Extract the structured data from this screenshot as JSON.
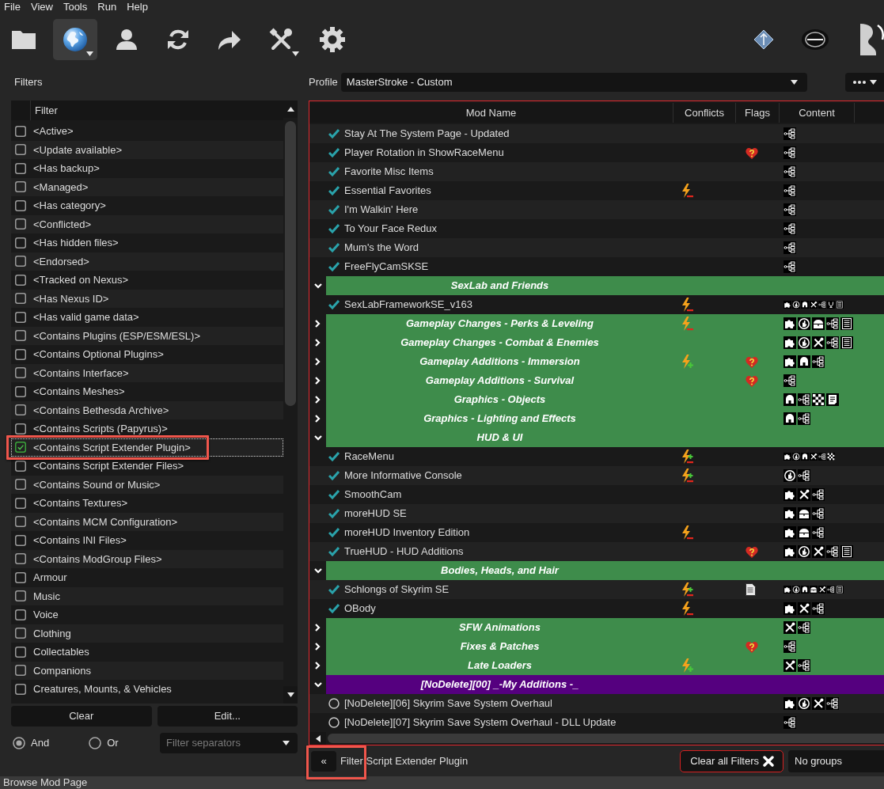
{
  "menu": [
    "File",
    "View",
    "Tools",
    "Run",
    "Help"
  ],
  "toolbar": {
    "buttons": [
      {
        "kind": "folder",
        "selected": false,
        "dropdown": false
      },
      {
        "kind": "globe",
        "selected": true,
        "dropdown": true
      },
      {
        "kind": "person",
        "selected": false,
        "dropdown": false
      },
      {
        "kind": "refresh",
        "selected": false,
        "dropdown": false
      },
      {
        "kind": "redo",
        "selected": false,
        "dropdown": false
      },
      {
        "kind": "tools",
        "selected": false,
        "dropdown": true
      },
      {
        "kind": "gear",
        "selected": false,
        "dropdown": false
      }
    ],
    "launchers": [
      {
        "kind": "diamond"
      },
      {
        "kind": "oval"
      },
      {
        "kind": "partial"
      }
    ]
  },
  "filters": {
    "title": "Filters",
    "column_header": "Filter",
    "items": [
      {
        "label": "<Active>",
        "checked": false,
        "selected": false,
        "highlighted": false
      },
      {
        "label": "<Update available>",
        "checked": false,
        "selected": false,
        "highlighted": false
      },
      {
        "label": "<Has backup>",
        "checked": false,
        "selected": false,
        "highlighted": false
      },
      {
        "label": "<Managed>",
        "checked": false,
        "selected": false,
        "highlighted": false
      },
      {
        "label": "<Has category>",
        "checked": false,
        "selected": false,
        "highlighted": false
      },
      {
        "label": "<Conflicted>",
        "checked": false,
        "selected": false,
        "highlighted": false
      },
      {
        "label": "<Has hidden files>",
        "checked": false,
        "selected": false,
        "highlighted": false
      },
      {
        "label": "<Endorsed>",
        "checked": false,
        "selected": false,
        "highlighted": false
      },
      {
        "label": "<Tracked on Nexus>",
        "checked": false,
        "selected": false,
        "highlighted": false
      },
      {
        "label": "<Has Nexus ID>",
        "checked": false,
        "selected": false,
        "highlighted": false
      },
      {
        "label": "<Has valid game data>",
        "checked": false,
        "selected": false,
        "highlighted": false
      },
      {
        "label": "<Contains Plugins (ESP/ESM/ESL)>",
        "checked": false,
        "selected": false,
        "highlighted": false
      },
      {
        "label": "<Contains Optional Plugins>",
        "checked": false,
        "selected": false,
        "highlighted": false
      },
      {
        "label": "<Contains Interface>",
        "checked": false,
        "selected": false,
        "highlighted": false
      },
      {
        "label": "<Contains Meshes>",
        "checked": false,
        "selected": false,
        "highlighted": false
      },
      {
        "label": "<Contains Bethesda Archive>",
        "checked": false,
        "selected": false,
        "highlighted": false
      },
      {
        "label": "<Contains Scripts (Papyrus)>",
        "checked": false,
        "selected": false,
        "highlighted": false
      },
      {
        "label": "<Contains Script Extender Plugin>",
        "checked": true,
        "selected": true,
        "highlighted": true
      },
      {
        "label": "<Contains Script Extender Files>",
        "checked": false,
        "selected": false,
        "highlighted": false
      },
      {
        "label": "<Contains Sound or Music>",
        "checked": false,
        "selected": false,
        "highlighted": false
      },
      {
        "label": "<Contains Textures>",
        "checked": false,
        "selected": false,
        "highlighted": false
      },
      {
        "label": "<Contains MCM Configuration>",
        "checked": false,
        "selected": false,
        "highlighted": false
      },
      {
        "label": "<Contains INI Files>",
        "checked": false,
        "selected": false,
        "highlighted": false
      },
      {
        "label": "<Contains ModGroup Files>",
        "checked": false,
        "selected": false,
        "highlighted": false
      },
      {
        "label": "Armour",
        "checked": false,
        "selected": false,
        "highlighted": false
      },
      {
        "label": "Music",
        "checked": false,
        "selected": false,
        "highlighted": false
      },
      {
        "label": "Voice",
        "checked": false,
        "selected": false,
        "highlighted": false
      },
      {
        "label": "Clothing",
        "checked": false,
        "selected": false,
        "highlighted": false
      },
      {
        "label": "Collectables",
        "checked": false,
        "selected": false,
        "highlighted": false
      },
      {
        "label": "Companions",
        "checked": false,
        "selected": false,
        "highlighted": false
      },
      {
        "label": "Creatures, Mounts, & Vehicles",
        "checked": false,
        "selected": false,
        "highlighted": false
      }
    ],
    "buttons": [
      "Clear",
      "Edit..."
    ],
    "modes": [
      {
        "label": "And",
        "selected": true
      },
      {
        "label": "Or",
        "selected": false
      }
    ],
    "separator_filter": {
      "placeholder": "Filter separators"
    }
  },
  "profile": {
    "label": "Profile",
    "value": "MasterStroke - Custom"
  },
  "mod_list": {
    "filter_active": true,
    "columns": [
      "Mod Name",
      "Conflicts",
      "Flags",
      "Content"
    ],
    "rows": [
      {
        "kind": "mod",
        "name": "Stay At The System Page - Updated",
        "active": true,
        "content": [
          {
            "kind": "scripts"
          }
        ]
      },
      {
        "kind": "mod",
        "name": "Player Rotation in ShowRaceMenu",
        "active": true,
        "flag": {
          "kind": "endorse"
        },
        "content": [
          {
            "kind": "scripts"
          }
        ]
      },
      {
        "kind": "mod",
        "name": "Favorite Misc Items",
        "active": true,
        "content": [
          {
            "kind": "scripts"
          }
        ]
      },
      {
        "kind": "mod",
        "name": "Essential Favorites",
        "active": true,
        "conflict": {
          "kind": "loses"
        },
        "content": [
          {
            "kind": "scripts"
          }
        ]
      },
      {
        "kind": "mod",
        "name": "I'm Walkin' Here",
        "active": true,
        "content": [
          {
            "kind": "scripts"
          }
        ]
      },
      {
        "kind": "mod",
        "name": "To Your Face Redux",
        "active": true,
        "content": [
          {
            "kind": "scripts"
          }
        ]
      },
      {
        "kind": "mod",
        "name": "Mum's the Word",
        "active": true,
        "content": [
          {
            "kind": "scripts"
          }
        ]
      },
      {
        "kind": "mod",
        "name": "FreeFlyCamSKSE",
        "active": true,
        "content": [
          {
            "kind": "scripts"
          }
        ]
      },
      {
        "kind": "separator",
        "name": "SexLab and Friends",
        "expanded": true,
        "color": "#3e8c4b"
      },
      {
        "kind": "mod",
        "name": "SexLabFrameworkSE_v163",
        "active": true,
        "conflict": {
          "kind": "loses"
        },
        "content": [
          {
            "kind": "plugins"
          },
          {
            "kind": "interface"
          },
          {
            "kind": "meshes"
          },
          {
            "kind": "skse"
          },
          {
            "kind": "scripts"
          },
          {
            "kind": "sound"
          },
          {
            "kind": "mcm"
          }
        ]
      },
      {
        "kind": "separator",
        "name": "Gameplay Changes - Perks & Leveling",
        "expanded": false,
        "color": "#3e8c4b",
        "conflict": {
          "kind": "loses"
        },
        "content": [
          {
            "kind": "plugins"
          },
          {
            "kind": "interface"
          },
          {
            "kind": "bsa"
          },
          {
            "kind": "scripts"
          },
          {
            "kind": "mcm"
          }
        ]
      },
      {
        "kind": "separator",
        "name": "Gameplay Changes - Combat & Enemies",
        "expanded": false,
        "color": "#3e8c4b",
        "content": [
          {
            "kind": "plugins"
          },
          {
            "kind": "interface"
          },
          {
            "kind": "skse"
          },
          {
            "kind": "scripts"
          },
          {
            "kind": "mcm"
          }
        ]
      },
      {
        "kind": "separator",
        "name": "Gameplay Additions - Immersion",
        "expanded": false,
        "color": "#3e8c4b",
        "conflict": {
          "kind": "wins"
        },
        "flag": {
          "kind": "endorse"
        },
        "content": [
          {
            "kind": "plugins"
          },
          {
            "kind": "meshes"
          },
          {
            "kind": "scripts"
          }
        ]
      },
      {
        "kind": "separator",
        "name": "Gameplay Additions - Survival",
        "expanded": false,
        "color": "#3e8c4b",
        "flag": {
          "kind": "endorse"
        },
        "content": [
          {
            "kind": "scripts"
          }
        ]
      },
      {
        "kind": "separator",
        "name": "Graphics - Objects",
        "expanded": false,
        "color": "#3e8c4b",
        "content": [
          {
            "kind": "meshes"
          },
          {
            "kind": "scripts"
          },
          {
            "kind": "textures"
          },
          {
            "kind": "strings"
          }
        ]
      },
      {
        "kind": "separator",
        "name": "Graphics - Lighting and Effects",
        "expanded": false,
        "color": "#3e8c4b",
        "content": [
          {
            "kind": "meshes"
          },
          {
            "kind": "scripts"
          }
        ]
      },
      {
        "kind": "separator",
        "name": "HUD & UI",
        "expanded": true,
        "color": "#3e8c4b"
      },
      {
        "kind": "mod",
        "name": "RaceMenu",
        "active": true,
        "conflict": {
          "kind": "mixed"
        },
        "content": [
          {
            "kind": "plugins"
          },
          {
            "kind": "interface"
          },
          {
            "kind": "meshes"
          },
          {
            "kind": "skse"
          },
          {
            "kind": "scripts"
          },
          {
            "kind": "textures"
          }
        ]
      },
      {
        "kind": "mod",
        "name": "More Informative Console",
        "active": true,
        "conflict": {
          "kind": "mixed"
        },
        "content": [
          {
            "kind": "interface"
          },
          {
            "kind": "scripts"
          }
        ]
      },
      {
        "kind": "mod",
        "name": "SmoothCam",
        "active": true,
        "content": [
          {
            "kind": "plugins"
          },
          {
            "kind": "skse"
          },
          {
            "kind": "scripts"
          }
        ]
      },
      {
        "kind": "mod",
        "name": "moreHUD SE",
        "active": true,
        "content": [
          {
            "kind": "plugins"
          },
          {
            "kind": "bsa"
          },
          {
            "kind": "scripts"
          }
        ]
      },
      {
        "kind": "mod",
        "name": "moreHUD Inventory Edition",
        "active": true,
        "conflict": {
          "kind": "loses"
        },
        "content": [
          {
            "kind": "plugins"
          },
          {
            "kind": "bsa"
          },
          {
            "kind": "scripts"
          }
        ]
      },
      {
        "kind": "mod",
        "name": "TrueHUD - HUD Additions",
        "active": true,
        "flag": {
          "kind": "endorse"
        },
        "content": [
          {
            "kind": "plugins"
          },
          {
            "kind": "interface"
          },
          {
            "kind": "skse"
          },
          {
            "kind": "scripts"
          },
          {
            "kind": "mcm"
          }
        ]
      },
      {
        "kind": "separator",
        "name": "Bodies, Heads, and Hair",
        "expanded": true,
        "color": "#3e8c4b"
      },
      {
        "kind": "mod",
        "name": "Schlongs of Skyrim SE",
        "active": true,
        "conflict": {
          "kind": "mixed"
        },
        "flag": {
          "kind": "notes"
        },
        "content": [
          {
            "kind": "plugins"
          },
          {
            "kind": "interface"
          },
          {
            "kind": "meshes"
          },
          {
            "kind": "bsa"
          },
          {
            "kind": "skse"
          },
          {
            "kind": "scripts"
          },
          {
            "kind": "mcm"
          }
        ]
      },
      {
        "kind": "mod",
        "name": "OBody",
        "active": true,
        "conflict": {
          "kind": "loses"
        },
        "content": [
          {
            "kind": "plugins"
          },
          {
            "kind": "skse"
          },
          {
            "kind": "scripts"
          }
        ]
      },
      {
        "kind": "separator",
        "name": "SFW Animations",
        "expanded": false,
        "color": "#3e8c4b",
        "content": [
          {
            "kind": "skse"
          },
          {
            "kind": "scripts"
          }
        ]
      },
      {
        "kind": "separator",
        "name": "Fixes & Patches",
        "expanded": false,
        "color": "#3e8c4b",
        "flag": {
          "kind": "endorse"
        },
        "content": [
          {
            "kind": "scripts"
          }
        ]
      },
      {
        "kind": "separator",
        "name": "Late Loaders",
        "expanded": false,
        "color": "#3e8c4b",
        "conflict": {
          "kind": "wins"
        },
        "content": [
          {
            "kind": "skse"
          },
          {
            "kind": "scripts"
          }
        ]
      },
      {
        "kind": "separator",
        "name": "[NoDelete][00] _-My Additions -_",
        "expanded": true,
        "color": "#55007f"
      },
      {
        "kind": "mod",
        "name": "[NoDelete][06] Skyrim Save System Overhaul",
        "active": false,
        "content": [
          {
            "kind": "plugins"
          },
          {
            "kind": "interface"
          },
          {
            "kind": "skse"
          },
          {
            "kind": "scripts"
          }
        ]
      },
      {
        "kind": "mod",
        "name": "[NoDelete][07] Skyrim Save System Overhaul - DLL Update",
        "active": false,
        "content": [
          {
            "kind": "scripts"
          }
        ]
      }
    ]
  },
  "bottom_bar": {
    "collapse": {
      "label": "«",
      "highlighted": true
    },
    "filter_text": "Filter Script Extender Plugin",
    "clear_button": "Clear all Filters",
    "grouping": "No groups"
  },
  "status_bar": "Browse Mod Page"
}
